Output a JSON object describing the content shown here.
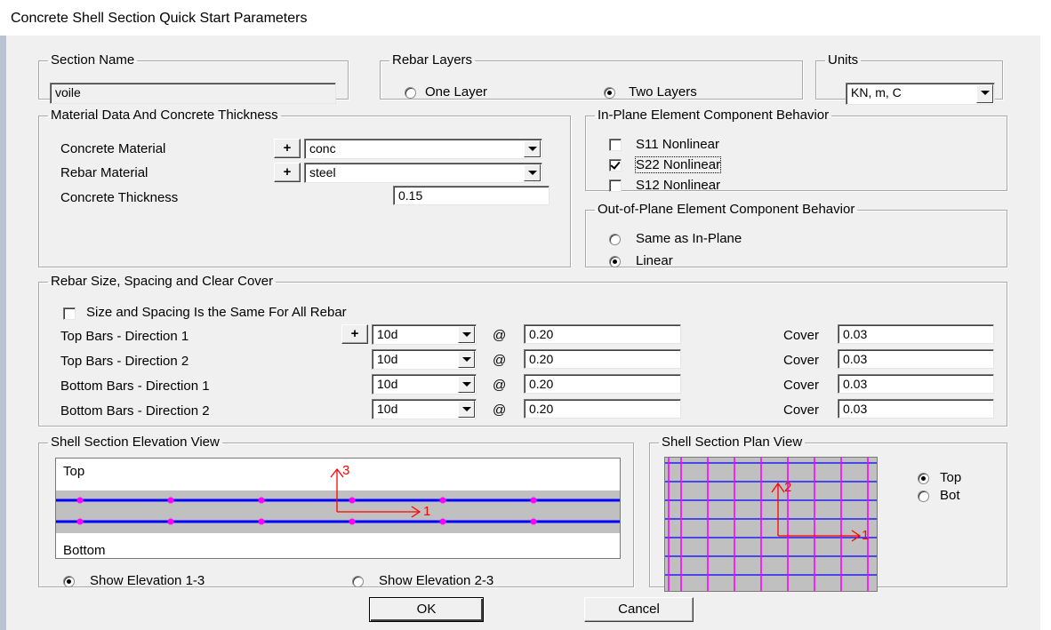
{
  "window": {
    "title": "Concrete Shell Section Quick Start Parameters"
  },
  "section_name": {
    "legend": "Section Name",
    "value": "voile"
  },
  "rebar_layers": {
    "legend": "Rebar Layers",
    "one_layer": "One Layer",
    "two_layers": "Two Layers",
    "selected": "Two Layers"
  },
  "units": {
    "legend": "Units",
    "value": "KN, m, C"
  },
  "material": {
    "legend": "Material Data And Concrete Thickness",
    "concrete_label": "Concrete Material",
    "concrete_value": "conc",
    "rebar_label": "Rebar Material",
    "rebar_value": "steel",
    "thickness_label": "Concrete Thickness",
    "thickness_value": "0.15",
    "plus": "+"
  },
  "inplane": {
    "legend": "In-Plane Element Component Behavior",
    "s11": {
      "label": "S11 Nonlinear",
      "checked": false
    },
    "s22": {
      "label": "S22 Nonlinear",
      "checked": true
    },
    "s12": {
      "label": "S12 Nonlinear",
      "checked": false
    }
  },
  "outplane": {
    "legend": "Out-of-Plane Element Component Behavior",
    "same": "Same as In-Plane",
    "linear": "Linear",
    "selected": "Linear"
  },
  "rebar": {
    "legend": "Rebar Size, Spacing and Clear Cover",
    "same_all": {
      "label": "Size and Spacing Is the Same For All Rebar",
      "checked": false
    },
    "at": "@",
    "cover_label": "Cover",
    "plus": "+",
    "rows": [
      {
        "label": "Top Bars  -  Direction 1",
        "size": "10d",
        "spacing": "0.20",
        "cover": "0.03"
      },
      {
        "label": "Top Bars  -  Direction 2",
        "size": "10d",
        "spacing": "0.20",
        "cover": "0.03"
      },
      {
        "label": "Bottom Bars  -  Direction 1",
        "size": "10d",
        "spacing": "0.20",
        "cover": "0.03"
      },
      {
        "label": "Bottom Bars  -  Direction 2",
        "size": "10d",
        "spacing": "0.20",
        "cover": "0.03"
      }
    ]
  },
  "elevation": {
    "legend": "Shell Section Elevation View",
    "top": "Top",
    "bottom": "Bottom",
    "axis_vertical": "3",
    "axis_horizontal": "1",
    "show_13": "Show Elevation 1-3",
    "show_23": "Show Elevation 2-3",
    "selected": "Show Elevation 1-3",
    "colors": {
      "rebar": "#0000ff",
      "dots": "#ff00ff",
      "axis": "#ff0000",
      "concrete": "#c0c0c0"
    }
  },
  "plan": {
    "legend": "Shell Section Plan View",
    "axis_vertical": "2",
    "axis_horizontal": "1",
    "top": "Top",
    "bot": "Bot",
    "selected": "Top"
  },
  "buttons": {
    "ok": "OK",
    "cancel": "Cancel"
  }
}
